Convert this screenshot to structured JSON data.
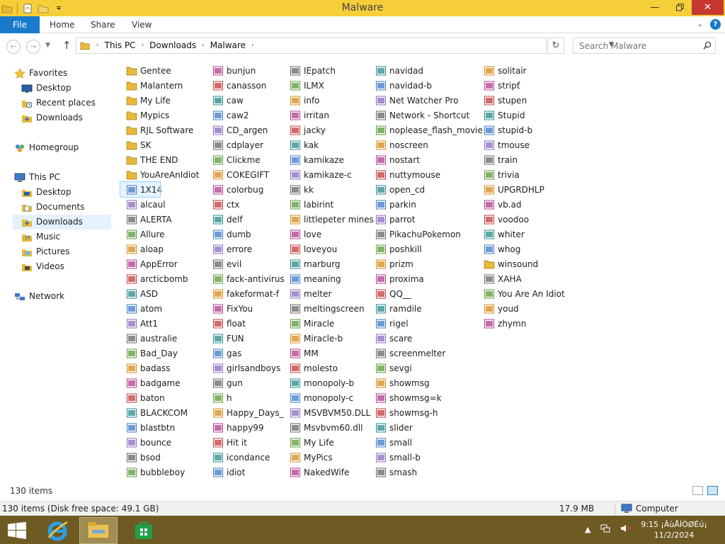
{
  "window": {
    "title": "Malware"
  },
  "ribbon": {
    "file": "File",
    "home": "Home",
    "share": "Share",
    "view": "View"
  },
  "address": {
    "crumbs": [
      "This PC",
      "Downloads",
      "Malware"
    ]
  },
  "search": {
    "placeholder": "Search Malware"
  },
  "nav": {
    "favorites": "Favorites",
    "desktop": "Desktop",
    "recent": "Recent places",
    "downloads": "Downloads",
    "homegroup": "Homegroup",
    "thispc": "This PC",
    "pc_desktop": "Desktop",
    "pc_documents": "Documents",
    "pc_downloads": "Downloads",
    "pc_music": "Music",
    "pc_pictures": "Pictures",
    "pc_videos": "Videos",
    "network": "Network"
  },
  "files": [
    [
      "Gentee",
      "Malantern",
      "My Life",
      "Mypics",
      "RJL Software",
      "SK",
      "THE END",
      "YouAreAnIdiot",
      "1X14",
      "alcaul",
      "ALERTA",
      "Allure",
      "aloap",
      "AppError",
      "arcticbomb",
      "ASD",
      "atom",
      "Att1",
      "australie",
      "Bad_Day",
      "badass",
      "badgame",
      "baton",
      "BLACKCOM",
      "blastbtn",
      "bounce",
      "bsod",
      "bubbleboy"
    ],
    [
      "bunjun",
      "canasson",
      "caw",
      "caw2",
      "CD_argen",
      "cdplayer",
      "Clickme",
      "COKEGIFT",
      "colorbug",
      "ctx",
      "delf",
      "dumb",
      "errore",
      "evil",
      "fack-antivirus",
      "fakeformat-f",
      "FixYou",
      "float",
      "FUN",
      "gas",
      "girlsandboys",
      "gun",
      "h",
      "Happy_Days_",
      "happy99",
      "Hit it",
      "icondance",
      "idiot"
    ],
    [
      "IEpatch",
      "ILMX",
      "info",
      "irritan",
      "jacky",
      "kak",
      "kamikaze",
      "kamikaze-c",
      "kk",
      "labirint",
      "littlepeter mines",
      "love",
      "loveyou",
      "marburg",
      "meaning",
      "melter",
      "meltingscreen",
      "Miracle",
      "Miracle-b",
      "MM",
      "molesto",
      "monopoly-b",
      "monopoly-c",
      "MSVBVM50.DLL",
      "Msvbvm60.dll",
      "My Life",
      "MyPics",
      "NakedWife"
    ],
    [
      "navidad",
      "navidad-b",
      "Net Watcher Pro",
      "Network - Shortcut",
      "noplease_flash_movie",
      "noscreen",
      "nostart",
      "nuttymouse",
      "open_cd",
      "parkin",
      "parrot",
      "PikachuPokemon",
      "poshkill",
      "prizm",
      "proxima",
      "QQ__",
      "ramdile",
      "rigel",
      "scare",
      "screenmelter",
      "sevgi",
      "showmsg",
      "showmsg=k",
      "showmsg-h",
      "slider",
      "small",
      "small-b",
      "smash"
    ],
    [
      "solitair",
      "stripť",
      "stupen",
      "Stupid",
      "stupid-b",
      "tmouse",
      "train",
      "trivia",
      "UPGRDHLP",
      "vb.ad",
      "voodoo",
      "whiter",
      "whog",
      "winsound",
      "XAHA",
      "You Are An Idiot",
      "youd",
      "zhymn"
    ]
  ],
  "icons": {
    "folder_items": [
      "Gentee",
      "Malantern",
      "My Life",
      "Mypics",
      "RJL Software",
      "SK",
      "THE END",
      "YouAreAnIdiot",
      "winsound"
    ]
  },
  "status": {
    "count": "130 items"
  },
  "infobar": {
    "left": "130 items (Disk free space: 49.1 GB)",
    "size": "17.9 MB",
    "zone": "Computer"
  },
  "clock": {
    "time": "9:15 ¡ÂùÅÍÓØÉú¡",
    "date": "11/2/2024"
  },
  "colors": {
    "titlebar": "#f6ce3a",
    "accent": "#1979ca",
    "taskbar": "#6e5a23",
    "close": "#c7372f"
  }
}
